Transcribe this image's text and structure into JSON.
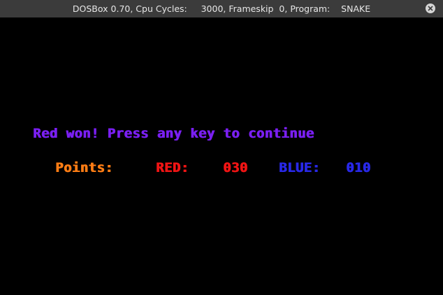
{
  "window": {
    "title": "DOSBox 0.70, Cpu Cycles:     3000, Frameskip  0, Program:    SNAKE",
    "close_icon": "close-icon"
  },
  "game": {
    "message": "Red won! Press any key to continue",
    "points_label": "Points:",
    "red_label": "RED:",
    "red_score": "030",
    "blue_label": "BLUE:",
    "blue_score": "010"
  },
  "colors": {
    "message": "#7a1ff2",
    "points_label": "#ff7d14",
    "red": "#f01414",
    "blue": "#2828e8",
    "background": "#000000",
    "titlebar": "#3b3b3b"
  }
}
